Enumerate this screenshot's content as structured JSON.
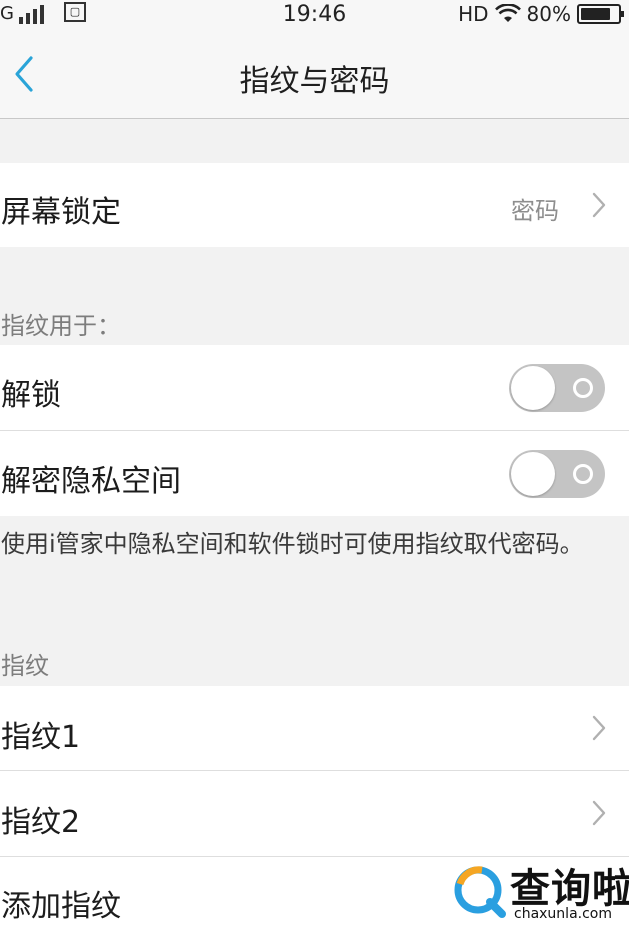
{
  "status_bar": {
    "carrier_mark": "G",
    "time": "19:46",
    "network": "HD",
    "battery": "80%",
    "battery_level": 0.8
  },
  "header": {
    "title": "指纹与密码"
  },
  "screen_lock": {
    "label": "屏幕锁定",
    "value": "密码"
  },
  "fingerprint_usage": {
    "section_label": "指纹用于：",
    "unlock_label": "解锁",
    "unlock_enabled": false,
    "private_space_label": "解密隐私空间",
    "private_space_enabled": false,
    "note": "使用i管家中隐私空间和软件锁时可使用指纹取代密码。"
  },
  "fingerprints": {
    "section_label": "指纹",
    "items": [
      {
        "label": "指纹1"
      },
      {
        "label": "指纹2"
      }
    ],
    "add_label": "添加指纹"
  },
  "watermark": {
    "text": "查询啦",
    "sub": "chaxunla.com"
  },
  "colors": {
    "accent": "#2aa4d8",
    "toggle_off": "#c4c4c4",
    "background": "#f2f2f2"
  },
  "icons": [
    "signal-icon",
    "sim-icon",
    "wifi-icon",
    "battery-icon",
    "back-arrow-icon",
    "chevron-right-icon"
  ]
}
